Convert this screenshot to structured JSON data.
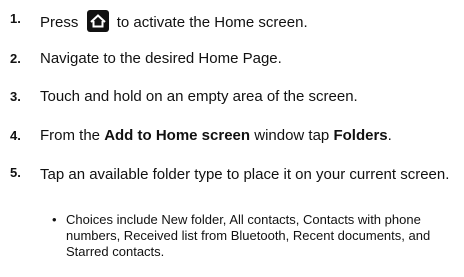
{
  "steps": [
    {
      "number": "1.",
      "before_icon": "Press",
      "icon": "home-icon",
      "after_icon": "to activate the Home screen."
    },
    {
      "number": "2.",
      "text": "Navigate to the desired Home Page."
    },
    {
      "number": "3.",
      "text": "Touch and hold on an empty area of the screen."
    },
    {
      "number": "4.",
      "prefix": "From the",
      "bold1": "Add to Home screen",
      "middle": "window tap",
      "bold2": "Folders",
      "suffix": "."
    },
    {
      "number": "5.",
      "text": "Tap an available folder type to place it on your current screen."
    }
  ],
  "bullet": {
    "marker": "•",
    "text": "Choices include New folder, All contacts, Contacts with phone numbers, Received list from Bluetooth, Recent documents, and Starred contacts."
  }
}
